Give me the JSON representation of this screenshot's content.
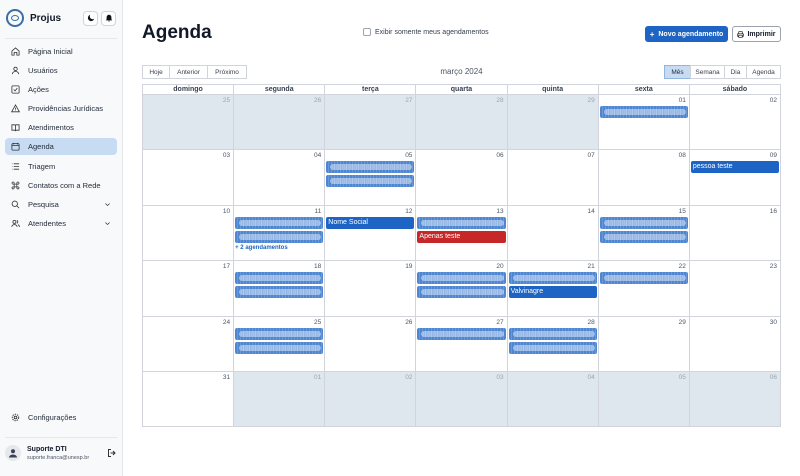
{
  "app": {
    "name": "Projus"
  },
  "sidebar": {
    "items": [
      {
        "label": "Página Inicial",
        "icon": "home-icon",
        "active": false
      },
      {
        "label": "Usuários",
        "icon": "user-icon",
        "active": false
      },
      {
        "label": "Ações",
        "icon": "check-square-icon",
        "active": false
      },
      {
        "label": "Providências Jurídicas",
        "icon": "alert-triangle-icon",
        "active": false
      },
      {
        "label": "Atendimentos",
        "icon": "book-open-icon",
        "active": false
      },
      {
        "label": "Agenda",
        "icon": "calendar-icon",
        "active": true
      },
      {
        "label": "Triagem",
        "icon": "list-icon",
        "active": false
      },
      {
        "label": "Contatos com a Rede",
        "icon": "command-icon",
        "active": false
      },
      {
        "label": "Pesquisa",
        "icon": "search-icon",
        "active": false,
        "expandable": true
      },
      {
        "label": "Atendentes",
        "icon": "users-icon",
        "active": false,
        "expandable": true
      }
    ],
    "settings_label": "Configurações",
    "user": {
      "name": "Suporte DTI",
      "email": "suporte.franca@unesp.br"
    }
  },
  "page": {
    "title": "Agenda",
    "only_mine_label": "Exibir somente meus agendamentos",
    "new_button": "Novo agendamento",
    "print_button": "Imprimir"
  },
  "toolbar": {
    "today": "Hoje",
    "prev": "Anterior",
    "next": "Próximo",
    "period": "março 2024",
    "views": [
      "Mês",
      "Semana",
      "Dia",
      "Agenda"
    ],
    "active_view": "Mês"
  },
  "calendar": {
    "weekdays": [
      "domingo",
      "segunda",
      "terça",
      "quarta",
      "quinta",
      "sexta",
      "sábado"
    ],
    "weeks": [
      [
        {
          "d": "25",
          "o": true
        },
        {
          "d": "26",
          "o": true
        },
        {
          "d": "27",
          "o": true
        },
        {
          "d": "28",
          "o": true
        },
        {
          "d": "29",
          "o": true
        },
        {
          "d": "01"
        },
        {
          "d": "02"
        }
      ],
      [
        {
          "d": "03"
        },
        {
          "d": "04"
        },
        {
          "d": "05"
        },
        {
          "d": "06"
        },
        {
          "d": "07"
        },
        {
          "d": "08"
        },
        {
          "d": "09"
        }
      ],
      [
        {
          "d": "10"
        },
        {
          "d": "11"
        },
        {
          "d": "12"
        },
        {
          "d": "13"
        },
        {
          "d": "14"
        },
        {
          "d": "15"
        },
        {
          "d": "16"
        }
      ],
      [
        {
          "d": "17"
        },
        {
          "d": "18"
        },
        {
          "d": "19"
        },
        {
          "d": "20"
        },
        {
          "d": "21"
        },
        {
          "d": "22"
        },
        {
          "d": "23"
        }
      ],
      [
        {
          "d": "24"
        },
        {
          "d": "25"
        },
        {
          "d": "26"
        },
        {
          "d": "27"
        },
        {
          "d": "28"
        },
        {
          "d": "29"
        },
        {
          "d": "30"
        }
      ],
      [
        {
          "d": "31"
        },
        {
          "d": "01",
          "o": true
        },
        {
          "d": "02",
          "o": true
        },
        {
          "d": "03",
          "o": true
        },
        {
          "d": "04",
          "o": true
        },
        {
          "d": "05",
          "o": true
        },
        {
          "d": "06",
          "o": true
        }
      ]
    ],
    "events": [
      {
        "week": 0,
        "day": 5,
        "slot": 0,
        "title": "",
        "redacted": true
      },
      {
        "week": 1,
        "day": 2,
        "slot": 0,
        "title": "",
        "redacted": true
      },
      {
        "week": 1,
        "day": 2,
        "slot": 1,
        "title": "",
        "redacted": true
      },
      {
        "week": 1,
        "day": 6,
        "slot": 0,
        "title": "pessoa teste"
      },
      {
        "week": 2,
        "day": 1,
        "slot": 0,
        "title": "",
        "redacted": true
      },
      {
        "week": 2,
        "day": 1,
        "slot": 1,
        "title": "",
        "redacted": true
      },
      {
        "week": 2,
        "day": 2,
        "slot": 0,
        "title": "Nome Social"
      },
      {
        "week": 2,
        "day": 3,
        "slot": 0,
        "title": "",
        "redacted": true
      },
      {
        "week": 2,
        "day": 3,
        "slot": 1,
        "title": "Apenas teste",
        "color": "red"
      },
      {
        "week": 2,
        "day": 5,
        "slot": 0,
        "title": "",
        "redacted": true
      },
      {
        "week": 2,
        "day": 5,
        "slot": 1,
        "title": "",
        "redacted": true
      },
      {
        "week": 3,
        "day": 1,
        "slot": 0,
        "title": "",
        "redacted": true
      },
      {
        "week": 3,
        "day": 1,
        "slot": 1,
        "title": "",
        "redacted": true
      },
      {
        "week": 3,
        "day": 3,
        "slot": 0,
        "title": "",
        "redacted": true
      },
      {
        "week": 3,
        "day": 3,
        "slot": 1,
        "title": "",
        "redacted": true
      },
      {
        "week": 3,
        "day": 4,
        "slot": 0,
        "title": "",
        "redacted": true
      },
      {
        "week": 3,
        "day": 4,
        "slot": 1,
        "title": "Valvinagre"
      },
      {
        "week": 3,
        "day": 5,
        "slot": 0,
        "title": "",
        "redacted": true
      },
      {
        "week": 4,
        "day": 1,
        "slot": 0,
        "title": "",
        "redacted": true
      },
      {
        "week": 4,
        "day": 1,
        "slot": 1,
        "title": "",
        "redacted": true
      },
      {
        "week": 4,
        "day": 3,
        "slot": 0,
        "title": "",
        "redacted": true
      },
      {
        "week": 4,
        "day": 4,
        "slot": 0,
        "title": "",
        "redacted": true
      },
      {
        "week": 4,
        "day": 4,
        "slot": 1,
        "title": "",
        "redacted": true
      }
    ],
    "more": [
      {
        "week": 2,
        "day": 1,
        "label": "+ 2 agendamentos"
      }
    ]
  },
  "colors": {
    "accent": "#1d64c4",
    "event_red": "#c62828",
    "active_nav": "#c7dcf3",
    "other_month": "#dfe7ee"
  }
}
